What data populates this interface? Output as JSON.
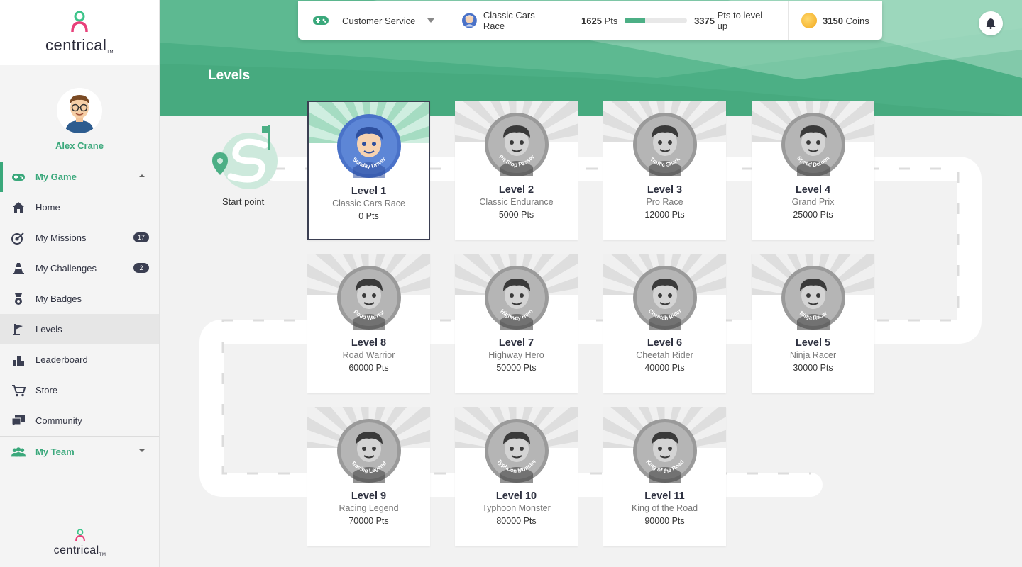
{
  "brand": {
    "name": "centrical",
    "tm": "TM"
  },
  "user": {
    "name": "Alex Crane"
  },
  "sidebar": {
    "my_game": "My Game",
    "items": [
      {
        "label": "Home",
        "icon": "home-icon"
      },
      {
        "label": "My Missions",
        "icon": "target-icon",
        "badge": "17"
      },
      {
        "label": "My Challenges",
        "icon": "cone-icon",
        "badge": "2"
      },
      {
        "label": "My Badges",
        "icon": "badge-icon"
      },
      {
        "label": "Levels",
        "icon": "flag-icon"
      },
      {
        "label": "Leaderboard",
        "icon": "leaderboard-icon"
      },
      {
        "label": "Store",
        "icon": "cart-icon"
      },
      {
        "label": "Community",
        "icon": "chat-icon"
      }
    ],
    "my_team": "My Team"
  },
  "header": {
    "page_title": "Levels",
    "game_select": "Customer Service",
    "race": "Classic Cars Race",
    "points": "1625",
    "points_unit": "Pts",
    "progress_fraction": 0.325,
    "to_level_up_value": "3375",
    "to_level_up_text": "Pts to level up",
    "coins_value": "3150",
    "coins_text": "Coins"
  },
  "board": {
    "start_label": "Start point",
    "levels": [
      {
        "level": "Level 1",
        "name": "Classic Cars Race",
        "pts": "0 Pts",
        "medal": "Sunday Driver",
        "current": true
      },
      {
        "level": "Level 2",
        "name": "Classic Endurance",
        "pts": "5000 Pts",
        "medal": "Pit Stop Passer"
      },
      {
        "level": "Level 3",
        "name": "Pro Race",
        "pts": "12000 Pts",
        "medal": "Traffic Shark"
      },
      {
        "level": "Level 4",
        "name": "Grand Prix",
        "pts": "25000 Pts",
        "medal": "Speed Demon"
      },
      {
        "level": "Level 5",
        "name": "Ninja Racer",
        "pts": "30000 Pts",
        "medal": "Ninja Racer"
      },
      {
        "level": "Level 6",
        "name": "Cheetah Rider",
        "pts": "40000 Pts",
        "medal": "Cheetah Rider"
      },
      {
        "level": "Level 7",
        "name": "Highway Hero",
        "pts": "50000 Pts",
        "medal": "Highway Hero"
      },
      {
        "level": "Level 8",
        "name": "Road Warrior",
        "pts": "60000 Pts",
        "medal": "Road Warrior"
      },
      {
        "level": "Level 9",
        "name": "Racing Legend",
        "pts": "70000 Pts",
        "medal": "Racing Legend"
      },
      {
        "level": "Level 10",
        "name": "Typhoon Monster",
        "pts": "80000 Pts",
        "medal": "Typhoon Monster"
      },
      {
        "level": "Level 11",
        "name": "King of the Road",
        "pts": "90000 Pts",
        "medal": "King of the Road"
      }
    ]
  },
  "colors": {
    "accent": "#4caf85",
    "dark": "#3b3f52",
    "medal_grey": "#8a8a8a",
    "medal_blue": "#4a72c8"
  }
}
